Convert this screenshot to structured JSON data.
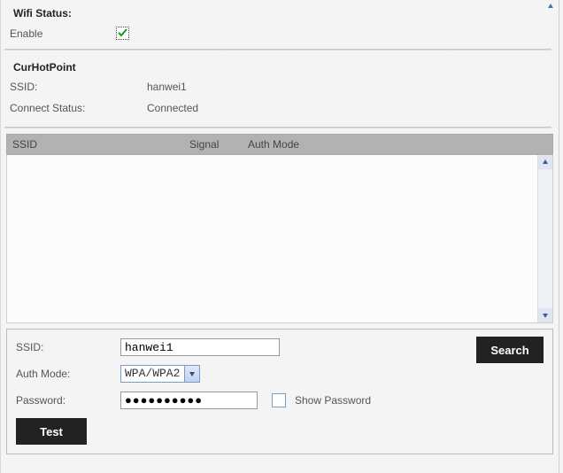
{
  "wifiStatus": {
    "title": "Wifi Status:",
    "enableLabel": "Enable",
    "enabled": true
  },
  "hotpoint": {
    "title": "CurHotPoint",
    "ssidLabel": "SSID:",
    "ssidValue": "hanwei1",
    "connectStatusLabel": "Connect Status:",
    "connectStatusValue": "Connected"
  },
  "tableHeaders": {
    "ssid": "SSID",
    "signal": "Signal",
    "authMode": "Auth Mode"
  },
  "tableRows": [],
  "form": {
    "ssidLabel": "SSID:",
    "ssidValue": "hanwei1",
    "authLabel": "Auth Mode:",
    "authValue": "WPA/WPA2",
    "passwordLabel": "Password:",
    "passwordMasked": "●●●●●●●●●●",
    "showPasswordLabel": "Show Password",
    "searchLabel": "Search",
    "testLabel": "Test"
  }
}
